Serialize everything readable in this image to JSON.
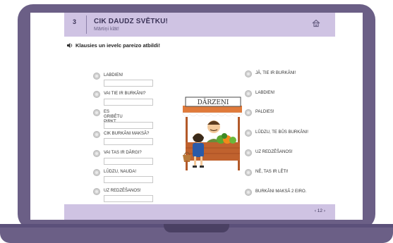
{
  "lesson": {
    "number": "3",
    "title": "CIK DAUDZ SVĒTKU!",
    "subtitle": "Mārtiņi klāt!"
  },
  "instruction": "Klausies un ievelc pareizo atbildi!",
  "left_items": [
    {
      "text": "LABDIEN!"
    },
    {
      "text": "VAI TIE IR BURKĀNI?"
    },
    {
      "text": "ES GRIBĒTU PIRKT\nBURKĀNUS!"
    },
    {
      "text": "CIK BURKĀNI MAKSĀ?"
    },
    {
      "text": "VAI TAS IR DĀRGI?"
    },
    {
      "text": "LŪDZU, NAUDA!"
    },
    {
      "text": "UZ REDZĒŠANOS!"
    }
  ],
  "right_items": [
    {
      "text": "JĀ, TIE IR BURKĀNI!"
    },
    {
      "text": "LABDIEN!"
    },
    {
      "text": "PALDIES!"
    },
    {
      "text": "LŪDZU, TE BŪS BURKĀNI!"
    },
    {
      "text": "UZ REDZĒŠANOS!"
    },
    {
      "text": "NĒ, TAS IR LĒTI!"
    },
    {
      "text": "BURKĀNI MAKSĀ 2 EIRO."
    }
  ],
  "illustration": {
    "sign_text": "DĀRZEŅI"
  },
  "pager": {
    "text": "‹ 12 ›"
  },
  "icons": {
    "home": "home-icon",
    "speaker": "speaker-icon"
  },
  "colors": {
    "frame": "#6b5f86",
    "header": "#cfc3e3",
    "accent_text": "#3c3458"
  }
}
